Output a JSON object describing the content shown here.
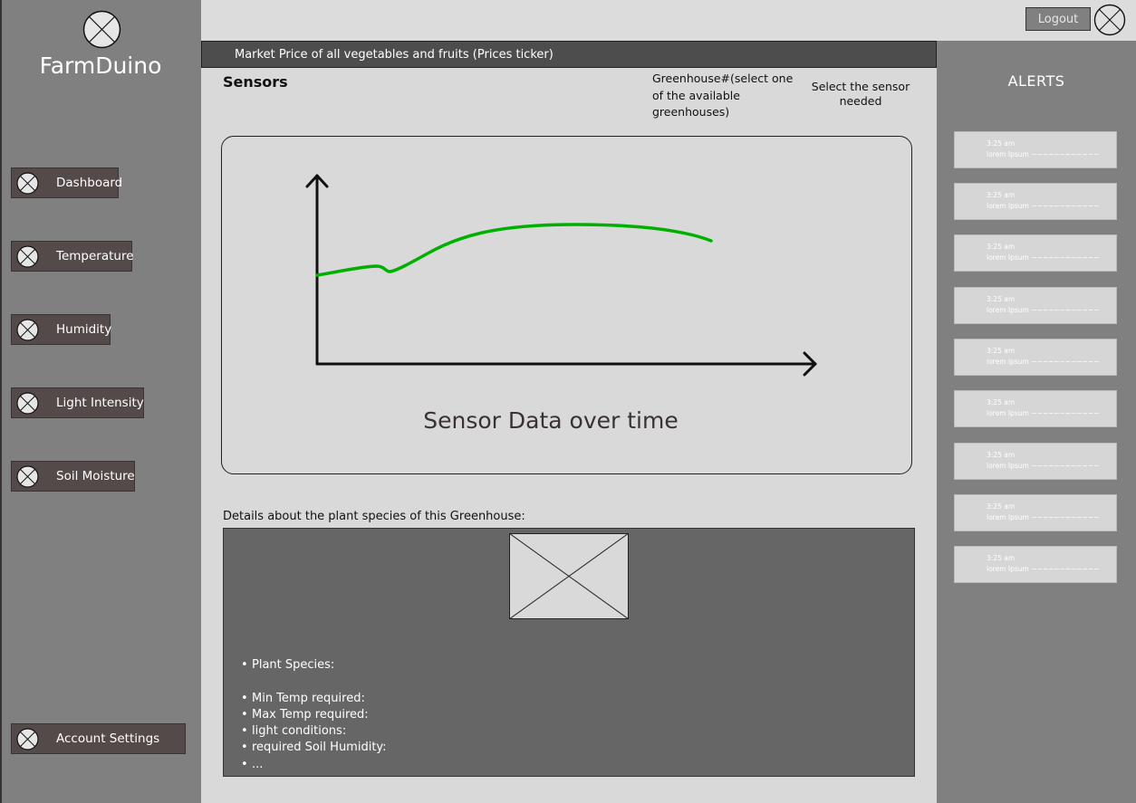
{
  "app": {
    "brand": "FarmDuino"
  },
  "sidebar": {
    "items": [
      {
        "label": "Dashboard",
        "icon": "placeholder-icon"
      },
      {
        "label": "Temperature",
        "icon": "placeholder-icon"
      },
      {
        "label": "Humidity",
        "icon": "placeholder-icon"
      },
      {
        "label": "Light Intensity",
        "icon": "placeholder-icon"
      },
      {
        "label": "Soil Moisture",
        "icon": "placeholder-icon"
      }
    ],
    "account": {
      "label": "Account Settings",
      "icon": "placeholder-icon"
    }
  },
  "header": {
    "logout_label": "Logout"
  },
  "ticker": {
    "text": "Market Price of all vegetables and fruits (Prices ticker)"
  },
  "main": {
    "sensors_title": "Sensors",
    "greenhouse_select": "Greenhouse#(select one of the available greenhouses)",
    "sensor_select": "Select the sensor needed",
    "chart_caption": "Sensor Data over time",
    "details_label": "Details about the plant species of this Greenhouse:",
    "details": [
      "Plant Species:",
      "",
      "Min Temp required:",
      "Max Temp required:",
      "light conditions:",
      "required Soil Humidity:",
      "..."
    ]
  },
  "alerts": {
    "title": "ALERTS",
    "items": [
      {
        "time": "3:25 am",
        "message": "lorem Ipsum ~~~~~~~~~~~~"
      },
      {
        "time": "3:25 am",
        "message": "lorem Ipsum ~~~~~~~~~~~~"
      },
      {
        "time": "3:25 am",
        "message": "lorem Ipsum ~~~~~~~~~~~~"
      },
      {
        "time": "3:25 am",
        "message": "lorem Ipsum ~~~~~~~~~~~~"
      },
      {
        "time": "3:25 am",
        "message": "lorem Ipsum ~~~~~~~~~~~~"
      },
      {
        "time": "3:25 am",
        "message": "lorem Ipsum ~~~~~~~~~~~~"
      },
      {
        "time": "3:25 am",
        "message": "lorem Ipsum ~~~~~~~~~~~~"
      },
      {
        "time": "3:25 am",
        "message": "lorem Ipsum ~~~~~~~~~~~~"
      },
      {
        "time": "3:25 am",
        "message": "lorem Ipsum ~~~~~~~~~~~~"
      }
    ]
  },
  "colors": {
    "sidebar": "#808080",
    "nav_item": "#554a4a",
    "ticker": "#4d4d4d",
    "details_panel": "#666666",
    "chart_line": "#00b000"
  }
}
